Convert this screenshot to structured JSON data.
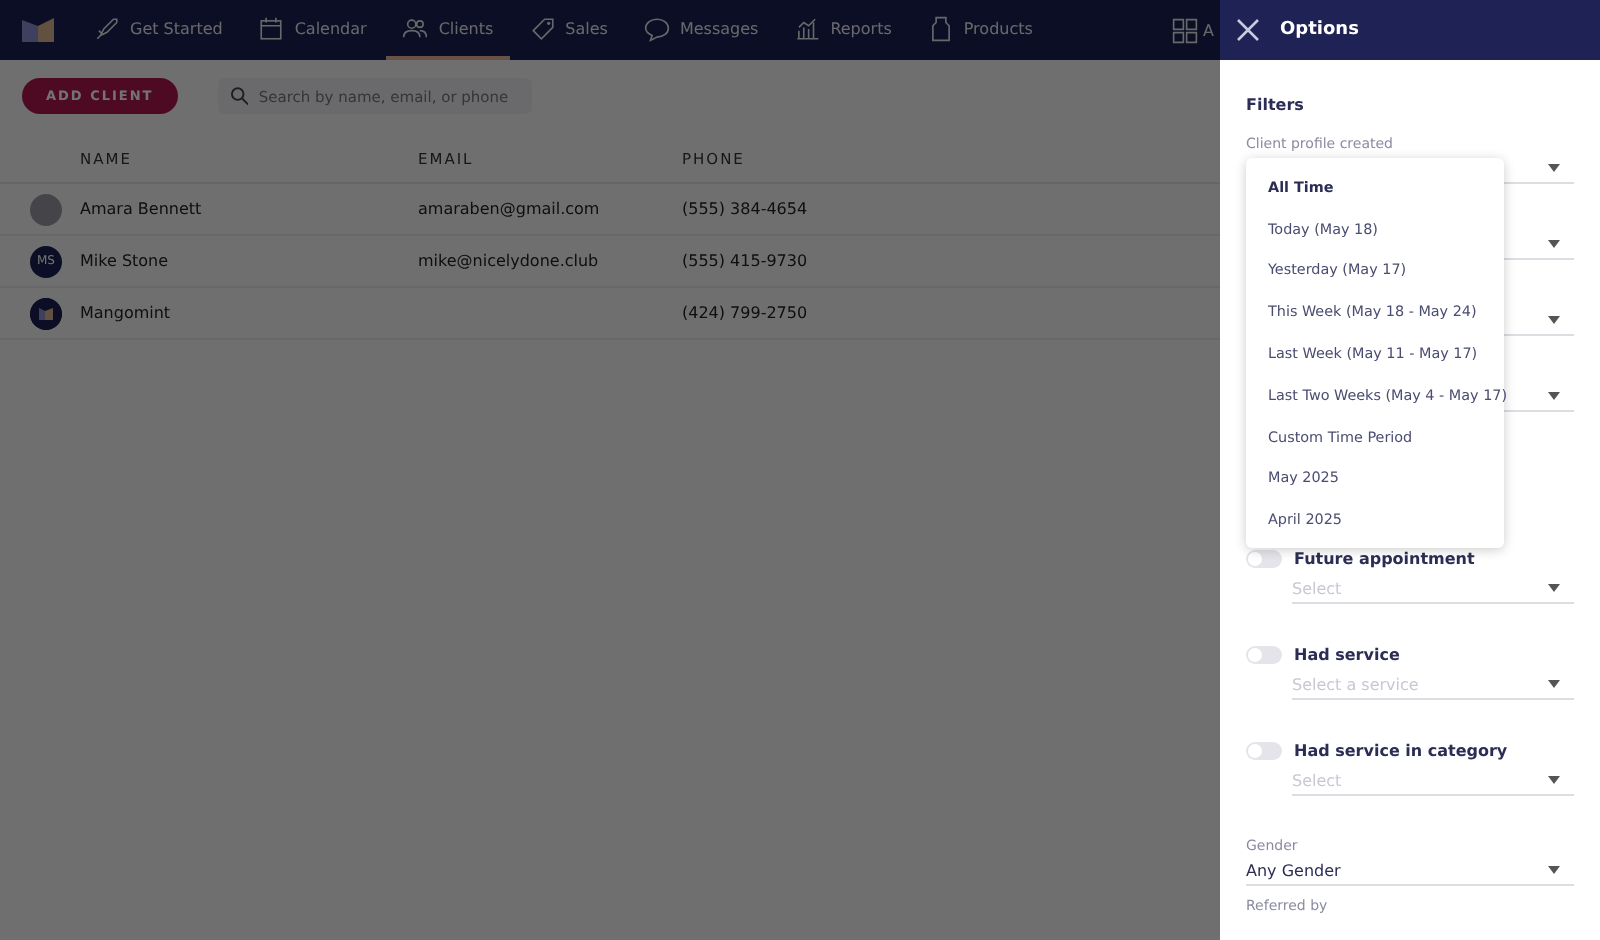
{
  "nav": {
    "items": [
      {
        "label": "Get Started",
        "selected": false
      },
      {
        "label": "Calendar",
        "selected": false
      },
      {
        "label": "Clients",
        "selected": true
      },
      {
        "label": "Sales",
        "selected": false
      },
      {
        "label": "Messages",
        "selected": false
      },
      {
        "label": "Reports",
        "selected": false
      },
      {
        "label": "Products",
        "selected": false
      }
    ],
    "apps_label": "A"
  },
  "toolbar": {
    "add_button": "ADD CLIENT",
    "search": {
      "placeholder": "Search by name, email, or phone"
    }
  },
  "table": {
    "columns": [
      "NAME",
      "EMAIL",
      "PHONE"
    ],
    "rows": [
      {
        "avatar": {
          "kind": "photo"
        },
        "name": "Amara Bennett",
        "email": "amaraben@gmail.com",
        "phone": "(555) 384-4654"
      },
      {
        "avatar": {
          "kind": "initials",
          "text": "MS"
        },
        "name": "Mike Stone",
        "email": "mike@nicelydone.club",
        "phone": "(555) 415-9730"
      },
      {
        "avatar": {
          "kind": "logo"
        },
        "name": "Mangomint",
        "phone": "(424) 799-2750"
      }
    ]
  },
  "panel": {
    "title": "Options",
    "section": "Filters",
    "filters": [
      {
        "kind": "select",
        "label": "Client profile created"
      },
      {
        "kind": "select"
      },
      {
        "kind": "select"
      },
      {
        "kind": "select"
      },
      {
        "kind": "toggle",
        "label": "Future appointment",
        "on": false,
        "placeholder": "Select"
      },
      {
        "kind": "toggle",
        "label": "Had service",
        "on": false,
        "placeholder": "Select a service"
      },
      {
        "kind": "toggle",
        "label": "Had service in category",
        "on": false,
        "placeholder": "Select"
      },
      {
        "kind": "select",
        "label": "Gender",
        "value": "Any Gender"
      },
      {
        "kind": "label",
        "label": "Referred by"
      }
    ],
    "dropdown": {
      "options": [
        {
          "label": "All Time",
          "selected": true
        },
        {
          "label": "Today (May 18)",
          "selected": false
        },
        {
          "label": "Yesterday (May 17)",
          "selected": false
        },
        {
          "label": "This Week (May 18 - May 24)",
          "selected": false
        },
        {
          "label": "Last Week (May 11 - May 17)",
          "selected": false
        },
        {
          "label": "Last Two Weeks (May 4 - May 17)",
          "selected": false
        },
        {
          "label": "Custom Time Period",
          "selected": false
        },
        {
          "label": "May 2025",
          "selected": false
        },
        {
          "label": "April 2025",
          "selected": false
        }
      ]
    }
  }
}
